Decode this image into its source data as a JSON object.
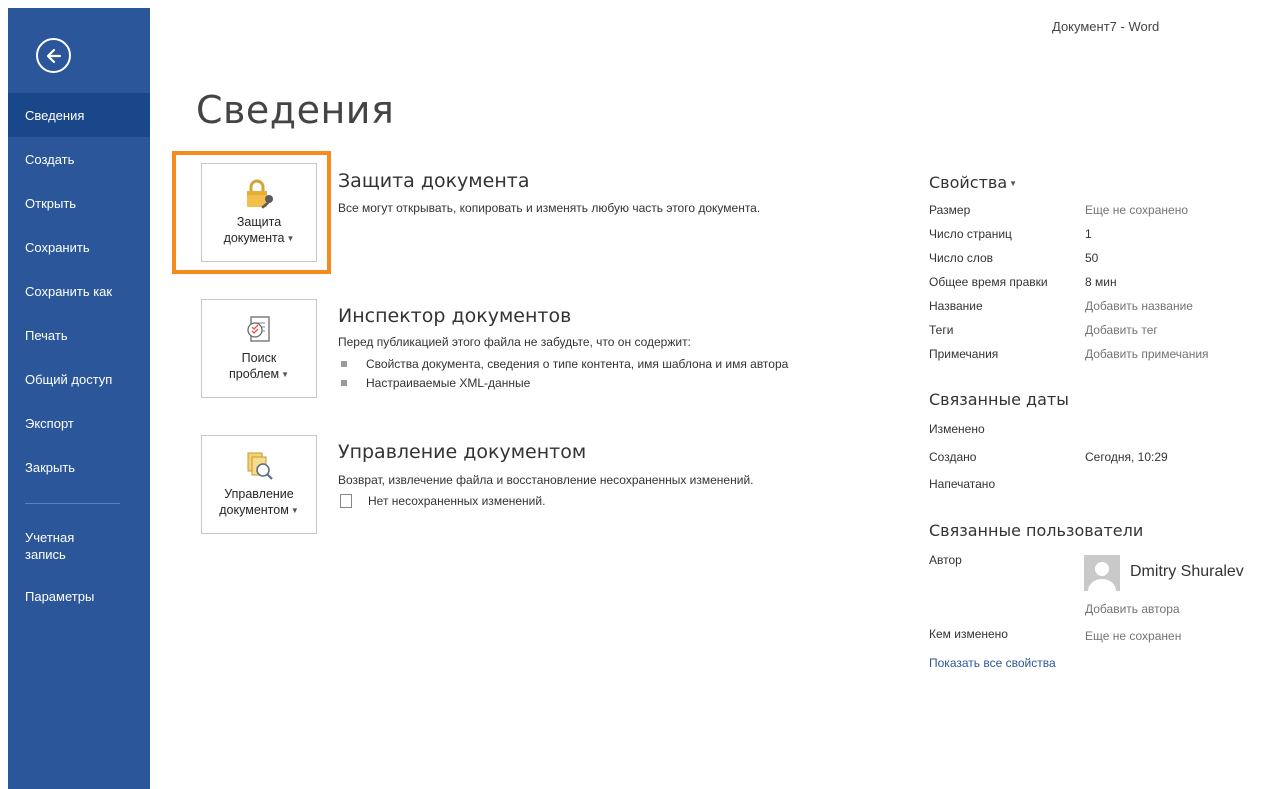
{
  "window": {
    "title": "Документ7 - Word"
  },
  "sidebar": {
    "items": [
      {
        "label": "Сведения",
        "active": true
      },
      {
        "label": "Создать"
      },
      {
        "label": "Открыть"
      },
      {
        "label": "Сохранить"
      },
      {
        "label": "Сохранить как"
      },
      {
        "label": "Печать"
      },
      {
        "label": "Общий доступ"
      },
      {
        "label": "Экспорт"
      },
      {
        "label": "Закрыть"
      }
    ],
    "bottom_items": [
      {
        "label": "Учетная запись"
      },
      {
        "label": "Параметры"
      }
    ],
    "back_icon": "back-arrow-circle-icon"
  },
  "page": {
    "title": "Сведения"
  },
  "protect": {
    "button_line1": "Защита",
    "button_line2": "документа",
    "title": "Защита документа",
    "desc": "Все могут открывать, копировать и изменять любую часть этого документа."
  },
  "inspect": {
    "button_line1": "Поиск",
    "button_line2": "проблем",
    "title": "Инспектор документов",
    "desc": "Перед публикацией этого файла не забудьте, что он содержит:",
    "bullets": [
      "Свойства документа, сведения о типе контента, имя шаблона и имя автора",
      "Настраиваемые XML-данные"
    ]
  },
  "manage": {
    "button_line1": "Управление",
    "button_line2": "документом",
    "title": "Управление документом",
    "desc": "Возврат, извлечение файла и восстановление несохраненных изменений.",
    "note": "Нет несохраненных изменений."
  },
  "properties": {
    "header": "Свойства",
    "rows": [
      {
        "label": "Размер",
        "value": "Еще не сохранено"
      },
      {
        "label": "Число страниц",
        "value": "1"
      },
      {
        "label": "Число слов",
        "value": "50"
      },
      {
        "label": "Общее время правки",
        "value": "8 мин"
      },
      {
        "label": "Название",
        "value": "Добавить название"
      },
      {
        "label": "Теги",
        "value": "Добавить тег"
      },
      {
        "label": "Примечания",
        "value": "Добавить примечания"
      }
    ]
  },
  "dates": {
    "header": "Связанные даты",
    "rows": [
      {
        "label": "Изменено",
        "value": ""
      },
      {
        "label": "Создано",
        "value": "Сегодня, 10:29"
      },
      {
        "label": "Напечатано",
        "value": ""
      }
    ]
  },
  "people": {
    "header": "Связанные пользователи",
    "author_label": "Автор",
    "author_name": "Dmitry Shuralev",
    "add_author": "Добавить автора",
    "modified_by_label": "Кем изменено",
    "modified_by_value": "Еще не сохранен",
    "show_all": "Показать все свойства"
  },
  "colors": {
    "sidebar": "#2b579a",
    "sidebar_active": "#19478a",
    "highlight": "#f68a1f",
    "link": "#2b579a"
  }
}
